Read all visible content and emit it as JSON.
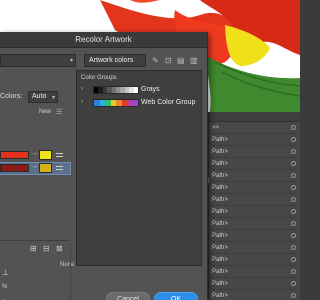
{
  "dialog": {
    "title": "Recolor Artwork",
    "name_field_value": "Artwork colors",
    "colors_label": "Colors:",
    "colors_select_value": "Auto",
    "new_column_label": "New",
    "none_label": "None",
    "color_groups_title": "Color Groups",
    "cancel_label": "Cancel",
    "ok_label": "OK"
  },
  "color_rows": [
    {
      "current_color": "#e2321d",
      "new_color": "#f0e41a",
      "selected": false
    },
    {
      "current_color": "#8c1a14",
      "new_color": "#d6b21a",
      "selected": true
    }
  ],
  "color_groups": [
    {
      "name": "Grays",
      "colors": [
        "#000000",
        "#1c1c1c",
        "#383838",
        "#555555",
        "#717171",
        "#8e8e8e",
        "#aaaaaa",
        "#c6c6c6",
        "#e3e3e3",
        "#ffffff"
      ]
    },
    {
      "name": "Web Color Group",
      "colors": [
        "#2f7fe0",
        "#2bb0e6",
        "#35c05a",
        "#d9d130",
        "#f28a23",
        "#e33a2a",
        "#c13aa0",
        "#8a4fd6"
      ]
    }
  ],
  "layers": [
    {
      "label": ">>"
    },
    {
      "label": "Path>"
    },
    {
      "label": "Path>"
    },
    {
      "label": "Path>"
    },
    {
      "label": "Path>"
    },
    {
      "label": "Path>"
    },
    {
      "label": "Path>"
    },
    {
      "label": "Path>"
    },
    {
      "label": "Path>"
    },
    {
      "label": "Path>"
    },
    {
      "label": "Path>"
    },
    {
      "label": "Path>"
    },
    {
      "label": "Path>"
    },
    {
      "label": "Path>"
    },
    {
      "label": "Path>"
    }
  ],
  "side_marks": [
    "%",
    "%"
  ],
  "colors": {
    "dialog_bg": "#535353",
    "accent_button": "#2f8fe8",
    "selection": "#5c6f8c"
  }
}
